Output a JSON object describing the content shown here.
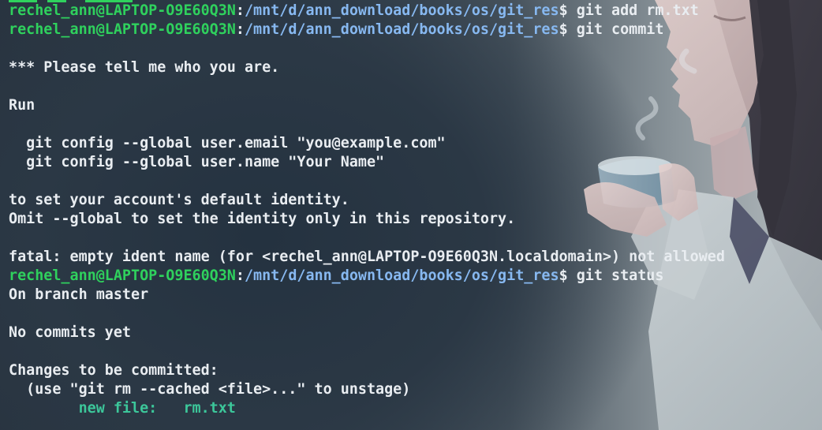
{
  "prompt": {
    "user_host": "rechel_ann@LAPTOP-O9E60Q3N",
    "separator": ":",
    "path": "/mnt/d/ann_download/books/os/git_res",
    "symbol": "$"
  },
  "lines": [
    {
      "kind": "prompt",
      "command": " git add rm.txt"
    },
    {
      "kind": "prompt",
      "command": " git commit"
    },
    {
      "kind": "blank"
    },
    {
      "kind": "text",
      "text": "*** Please tell me who you are."
    },
    {
      "kind": "blank"
    },
    {
      "kind": "text",
      "text": "Run"
    },
    {
      "kind": "blank"
    },
    {
      "kind": "text",
      "text": "  git config --global user.email \"you@example.com\""
    },
    {
      "kind": "text",
      "text": "  git config --global user.name \"Your Name\""
    },
    {
      "kind": "blank"
    },
    {
      "kind": "text",
      "text": "to set your account's default identity."
    },
    {
      "kind": "text",
      "text": "Omit --global to set the identity only in this repository."
    },
    {
      "kind": "blank"
    },
    {
      "kind": "text",
      "text": "fatal: empty ident name (for <rechel_ann@LAPTOP-O9E60Q3N.localdomain>) not allowed"
    },
    {
      "kind": "prompt",
      "command": " git status"
    },
    {
      "kind": "text",
      "text": "On branch master"
    },
    {
      "kind": "blank"
    },
    {
      "kind": "text",
      "text": "No commits yet"
    },
    {
      "kind": "blank"
    },
    {
      "kind": "text",
      "text": "Changes to be committed:"
    },
    {
      "kind": "text",
      "text": "  (use \"git rm --cached <file>...\" to unstage)"
    },
    {
      "kind": "staged",
      "label": "        new file:",
      "file": "   rm.txt"
    }
  ],
  "colors": {
    "prompt_user": "#2fd15d",
    "prompt_path": "#87b8f0",
    "output_text": "#e9edf1",
    "staged_file": "#3cc79a",
    "background": "#2d3a47"
  }
}
